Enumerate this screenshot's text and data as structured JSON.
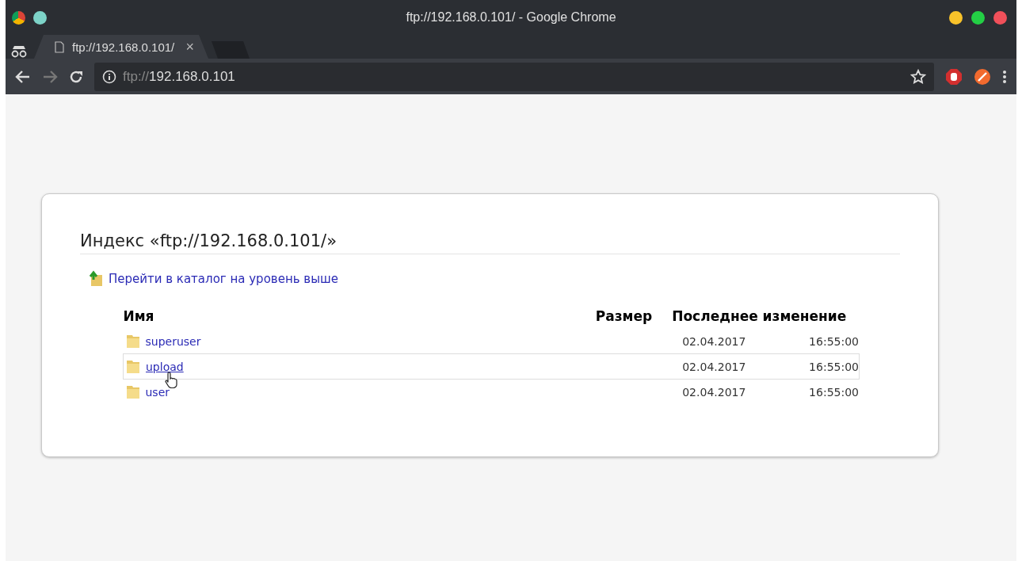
{
  "window": {
    "title": "ftp://192.168.0.101/ - Google Chrome"
  },
  "tabs": [
    {
      "label": "ftp://192.168.0.101/",
      "close": "×",
      "selected": true
    }
  ],
  "address_bar": {
    "scheme": "ftp://",
    "host": "192.168.0.101"
  },
  "page": {
    "heading": "Индекс «ftp://192.168.0.101/»",
    "parent_link": "Перейти в каталог на уровень выше",
    "columns": [
      "Имя",
      "Размер",
      "Последнее изменение"
    ],
    "rows": [
      {
        "name": "superuser",
        "date": "02.04.2017",
        "time": "16:55:00",
        "hovered": false
      },
      {
        "name": "upload",
        "date": "02.04.2017",
        "time": "16:55:00",
        "hovered": true
      },
      {
        "name": "user",
        "date": "02.04.2017",
        "time": "16:55:00",
        "hovered": false
      }
    ]
  }
}
